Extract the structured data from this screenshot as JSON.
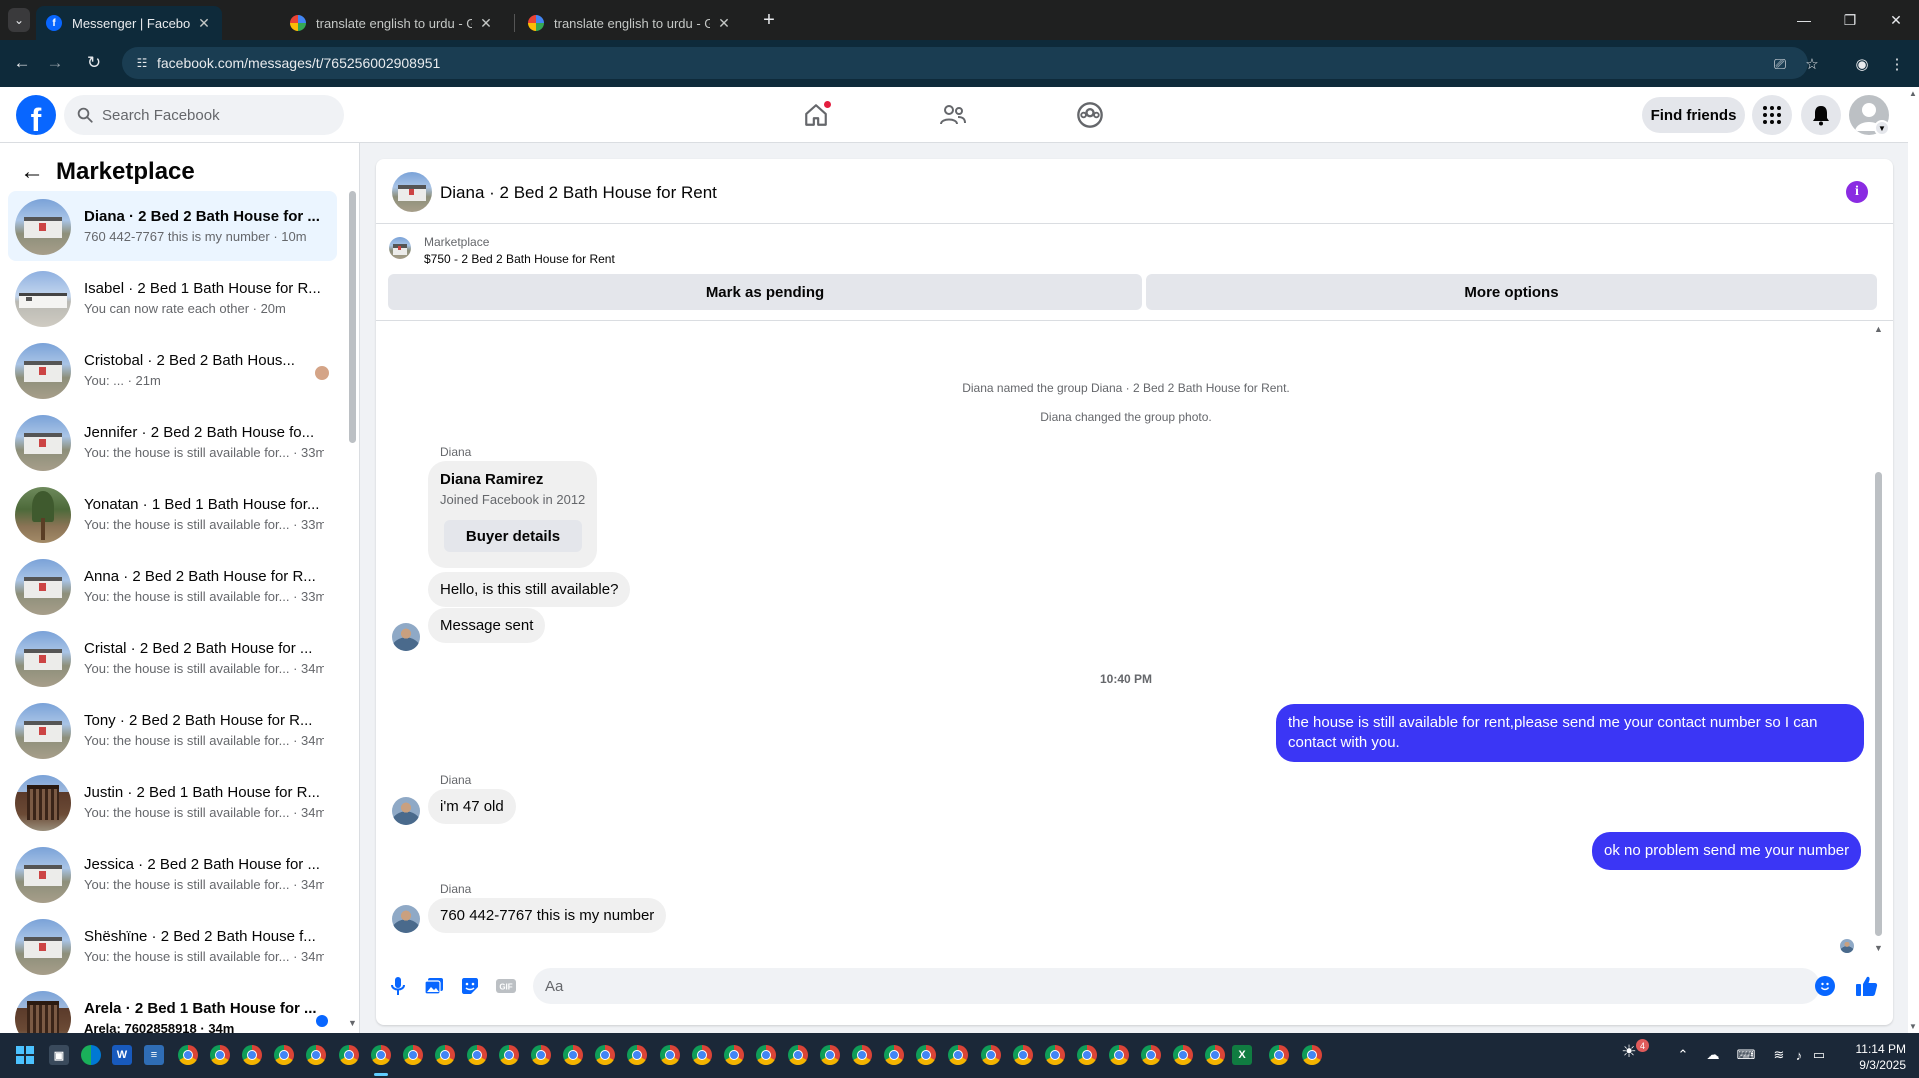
{
  "browser": {
    "tabs": [
      {
        "title": "Messenger | Facebook",
        "favicon": "facebook-icon",
        "active": true
      },
      {
        "title": "translate english to urdu - Goo",
        "favicon": "google-icon",
        "active": false
      },
      {
        "title": "translate english to urdu - Goo",
        "favicon": "google-icon",
        "active": false
      }
    ],
    "url": "facebook.com/messages/t/765256002908951"
  },
  "fbnav": {
    "search_placeholder": "Search Facebook",
    "find_friends": "Find friends"
  },
  "sidebar": {
    "title": "Marketplace",
    "chats": [
      {
        "name": "Diana · 2 Bed 2 Bath House for ...",
        "preview": "760 442-7767 this is my number · 10m",
        "active": true,
        "bold_name": true,
        "thumb": "house"
      },
      {
        "name": "Isabel · 2 Bed 1 Bath House for R...",
        "preview": "You can now rate each other · 20m",
        "active": false,
        "bold_name": false,
        "thumb": "low"
      },
      {
        "name": "Cristobal · 2 Bed 2 Bath Hous...",
        "preview": "You: ... · 21m",
        "active": false,
        "bold_name": false,
        "thumb": "house"
      },
      {
        "name": "Jennifer · 2 Bed 2 Bath House fo...",
        "preview": "You: the house is still available for... · 33m",
        "active": false,
        "bold_name": false,
        "thumb": "house"
      },
      {
        "name": "Yonatan · 1 Bed 1 Bath House for...",
        "preview": "You: the house is still available for... · 33m",
        "active": false,
        "bold_name": false,
        "thumb": "tree"
      },
      {
        "name": "Anna · 2 Bed 2 Bath House for R...",
        "preview": "You: the house is still available for... · 33m",
        "active": false,
        "bold_name": false,
        "thumb": "house"
      },
      {
        "name": "Cristal · 2 Bed 2 Bath House for ...",
        "preview": "You: the house is still available for... · 34m",
        "active": false,
        "bold_name": false,
        "thumb": "house"
      },
      {
        "name": "Tony · 2 Bed 2 Bath House for R...",
        "preview": "You: the house is still available for... · 34m",
        "active": false,
        "bold_name": false,
        "thumb": "house"
      },
      {
        "name": "Justin · 2 Bed 1 Bath House for R...",
        "preview": "You: the house is still available for... · 34m",
        "active": false,
        "bold_name": false,
        "thumb": "dark"
      },
      {
        "name": "Jessica · 2 Bed 2 Bath House for ...",
        "preview": "You: the house is still available for... · 34m",
        "active": false,
        "bold_name": false,
        "thumb": "house"
      },
      {
        "name": "Shëshïne · 2 Bed 2 Bath House f...",
        "preview": "You: the house is still available for... · 34m",
        "active": false,
        "bold_name": false,
        "thumb": "house"
      },
      {
        "name": "Arela · 2 Bed 1 Bath House for ...",
        "preview": "Arela: 7602858918 · 34m",
        "active": false,
        "bold_name": true,
        "thumb": "dark"
      }
    ]
  },
  "conversation": {
    "title": "Diana · 2 Bed 2 Bath House for Rent",
    "marketplace_label": "Marketplace",
    "listing": "$750 - 2 Bed 2 Bath House for Rent",
    "mark_pending": "Mark as pending",
    "more_options": "More options",
    "system_messages": [
      "Diana named the group Diana · 2 Bed 2 Bath House for Rent.",
      "Diana changed the group photo."
    ],
    "buyer_card": {
      "sender": "Diana",
      "name": "Diana Ramirez",
      "joined": "Joined Facebook in 2012",
      "button": "Buyer details"
    },
    "incoming_1": "Hello, is this still available?",
    "incoming_2": "Message sent",
    "timestamp": "10:40 PM",
    "outgoing_1": "the house is still available for rent,please send me your contact number so I can contact with you.",
    "sender_2": "Diana",
    "incoming_3": "i'm 47 old",
    "outgoing_2": "ok no problem send me your number",
    "sender_3": "Diana",
    "incoming_4": "760 442-7767 this is my number",
    "composer_placeholder": "Aa"
  },
  "taskbar": {
    "time": "11:14 PM",
    "date": "9/3/2025",
    "notification_badge": "4"
  },
  "colors": {
    "fb_blue": "#0866ff",
    "outgoing_bubble": "#3b36f5",
    "incoming_bubble": "#f0f0f0",
    "chrome_bar": "#0e2a3a",
    "info_purple": "#8a2be2"
  }
}
